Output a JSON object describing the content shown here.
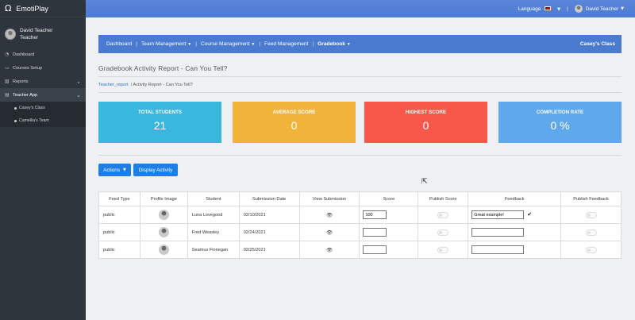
{
  "app": {
    "name": "EmotiPlay"
  },
  "sidebar": {
    "user_name": "David Teacher",
    "user_role": "Teacher",
    "items": [
      {
        "label": "Dashboard",
        "icon": "dashboard-icon"
      },
      {
        "label": "Courses Setup",
        "icon": "courses-icon"
      },
      {
        "label": "Reports",
        "icon": "reports-icon"
      },
      {
        "label": "Teacher App",
        "icon": "teacher-app-icon"
      }
    ],
    "sub_items": [
      "Casey's Class",
      "Camellia's Team"
    ]
  },
  "topbar": {
    "language_label": "Language",
    "separator": "|",
    "user_name": "David Teacher"
  },
  "nav": {
    "items": [
      "Dashboard",
      "Team Management",
      "Course Management",
      "Feed Management",
      "Gradebook"
    ],
    "class_name": "Casey's Class"
  },
  "page": {
    "title": "Gradebook Activity Report - Can You Tell?"
  },
  "breadcrumb": {
    "link": "Teacher_report",
    "current": "/ Activity Report - Can You Tell?"
  },
  "stats": [
    {
      "title": "TOTAL STUDENTS",
      "value": "21",
      "color": "#3ab7dc"
    },
    {
      "title": "AVERAGE SCORE",
      "value": "0",
      "color": "#f0b43a"
    },
    {
      "title": "HIGHEST SCORE",
      "value": "0",
      "color": "#f7584a"
    },
    {
      "title": "COMPLETION RATE",
      "value": "0 %",
      "color": "#5fa8ec"
    }
  ],
  "actions": {
    "actions_label": "Actions",
    "display_label": "Display Activity"
  },
  "table": {
    "headers": [
      "Feed Type",
      "Profile Image",
      "Student",
      "Submission Date",
      "View Submission",
      "Score",
      "Publish Score",
      "Feedback",
      "Publish Feedback"
    ],
    "rows": [
      {
        "feed_type": "public",
        "student": "Luna Lovegood",
        "date": "02/10/2021",
        "score": "100",
        "feedback": "Great example!"
      },
      {
        "feed_type": "public",
        "student": "Fred Weasley",
        "date": "02/24/2021",
        "score": "",
        "feedback": ""
      },
      {
        "feed_type": "public",
        "student": "Seamus Finnegan",
        "date": "02/25/2021",
        "score": "",
        "feedback": ""
      }
    ]
  }
}
